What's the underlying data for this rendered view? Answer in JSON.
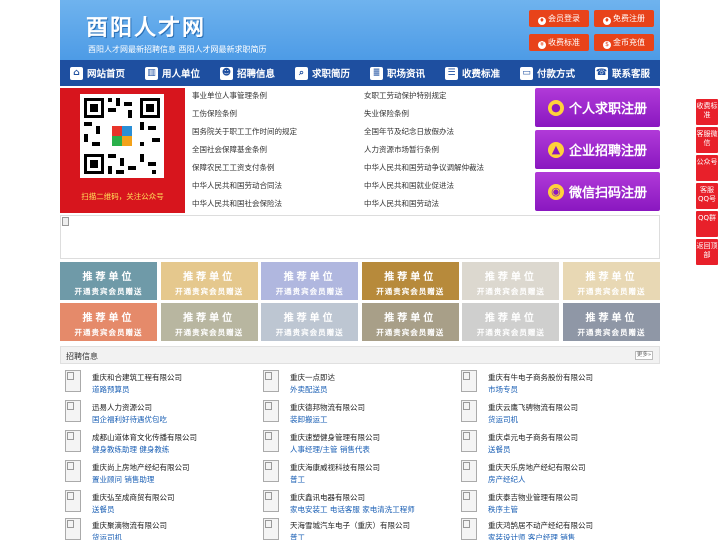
{
  "header": {
    "title": "酉阳人才网",
    "subtitle": "酉阳人才网最新招聘信息 酉阳人才网最新求职简历",
    "buttons": [
      "会员登录",
      "免费注册",
      "收费标准",
      "金币充值"
    ]
  },
  "nav": [
    "网站首页",
    "用人单位",
    "招聘信息",
    "求职简历",
    "职场资讯",
    "收费标准",
    "付款方式",
    "联系客服"
  ],
  "qr": {
    "caption": "扫描二维码，关注公众号"
  },
  "links": [
    [
      "事业单位人事管理条例",
      "女职工劳动保护特别规定"
    ],
    [
      "工伤保险条例",
      "失业保险条例"
    ],
    [
      "国务院关于职工工作时间的规定",
      "全国年节及纪念日放假办法"
    ],
    [
      "全国社会保障基金条例",
      "人力资源市场暂行条例"
    ],
    [
      "保障农民工工资支付条例",
      "中华人民共和国劳动争议调解仲裁法"
    ],
    [
      "中华人民共和国劳动合同法",
      "中华人民共和国就业促进法"
    ],
    [
      "中华人民共和国社会保险法",
      "中华人民共和国劳动法"
    ]
  ],
  "register": [
    "个人求职注册",
    "企业招聘注册",
    "微信扫码注册"
  ],
  "recommend": {
    "line1": "推荐单位",
    "line2": "开通贵宾会员赠送"
  },
  "recommend_colors": [
    "#6f9aa8",
    "#e5c88d",
    "#b0b7df",
    "#b78a3b",
    "#dcd8cf",
    "#e8d8b4",
    "#e58a6a",
    "#b8b6a0",
    "#bdc6d2",
    "#a89f88",
    "#cfcfce",
    "#8f97a6"
  ],
  "jobs_section": {
    "title": "招聘信息",
    "more": "更多»"
  },
  "jobs": [
    {
      "company": "重庆和合建筑工程有限公司",
      "positions": "道路预算员"
    },
    {
      "company": "重庆一点即达",
      "positions": "外卖配送员"
    },
    {
      "company": "重庆有牛电子商务股份有限公司",
      "positions": "市场专员"
    },
    {
      "company": "迅易人力资源公司",
      "positions": "国企福利好待遇优包吃"
    },
    {
      "company": "重庆德邦物流有限公司",
      "positions": "装卸搬运工"
    },
    {
      "company": "重庆云鹰飞骋物流有限公司",
      "positions": "货运司机"
    },
    {
      "company": "成都山道体育文化传播有限公司",
      "positions": "健身教练助理  健身教练"
    },
    {
      "company": "重庆速塑健身管理有限公司",
      "positions": "人事经理/主管  销售代表"
    },
    {
      "company": "重庆卓元电子商务有限公司",
      "positions": "送餐员"
    },
    {
      "company": "重庆尚上房地产经纪有限公司",
      "positions": "置业顾问  销售助理"
    },
    {
      "company": "重庆海康威视科技有限公司",
      "positions": "普工"
    },
    {
      "company": "重庆天乐房地产经纪有限公司",
      "positions": "房产经纪人"
    },
    {
      "company": "重庆弘至成商贸有限公司",
      "positions": "送餐员"
    },
    {
      "company": "重庆鑫讯电器有限公司",
      "positions": "家电安装工  电话客服  家电清洗工程师"
    },
    {
      "company": "重庆泰吉物业管理有限公司",
      "positions": "秩序主管"
    },
    {
      "company": "重庆聚滴物流有限公司",
      "positions": "货运司机"
    },
    {
      "company": "天海雪城汽车电子（重庆）有限公司",
      "positions": "普工"
    },
    {
      "company": "重庆鸿鹄居不动产经纪有限公司",
      "positions": "家装设计师  客户经理  销售"
    }
  ],
  "side": [
    "收费标准",
    "客服微信",
    "公众号",
    "客服QQ号",
    "QQ群",
    "返回顶部"
  ]
}
